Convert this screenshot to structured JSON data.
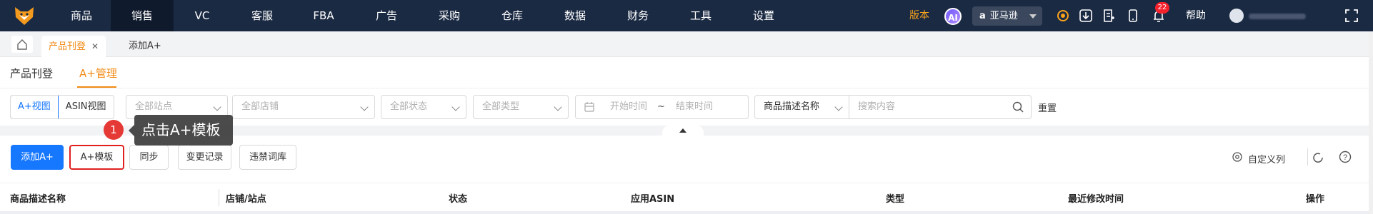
{
  "nav": {
    "items": [
      "商品",
      "销售",
      "VC",
      "客服",
      "FBA",
      "广告",
      "采购",
      "仓库",
      "数据",
      "财务",
      "工具",
      "设置"
    ],
    "active": "销售",
    "version_label": "版本",
    "ai_label": "AI",
    "platform": "亚马逊",
    "notification_count": "22",
    "help_label": "帮助"
  },
  "tabs": {
    "items": [
      {
        "label": "产品刊登",
        "active": true,
        "closable": true
      },
      {
        "label": "添加A+",
        "active": false,
        "closable": false
      }
    ],
    "close_glyph": "✕"
  },
  "subnav": {
    "items": [
      "产品刊登",
      "A+管理"
    ],
    "active": "A+管理"
  },
  "filters": {
    "view_toggle": [
      "A+视图",
      "ASIN视图"
    ],
    "site_placeholder": "全部站点",
    "shop_placeholder": "全部店铺",
    "status_placeholder": "全部状态",
    "type_placeholder": "全部类型",
    "start_placeholder": "开始时间",
    "range_sep": "~",
    "end_placeholder": "结束时间",
    "search_field": "商品描述名称",
    "search_placeholder": "搜索内容",
    "reset_label": "重置"
  },
  "toolbar": {
    "add_aplus": "添加A+",
    "aplus_template": "A+模板",
    "sync": "同步",
    "change_log": "变更记录",
    "banned_words": "违禁词库",
    "custom_columns": "自定义列"
  },
  "annotation": {
    "step": "1",
    "text": "点击A+模板"
  },
  "table": {
    "columns": [
      "商品描述名称",
      "店铺/站点",
      "状态",
      "应用ASIN",
      "类型",
      "最近修改时间",
      "操作"
    ]
  },
  "colors": {
    "topbar": "#1b2a43",
    "accent_orange": "#f28b16",
    "primary_blue": "#1677ff",
    "highlight_red": "#e02020"
  }
}
